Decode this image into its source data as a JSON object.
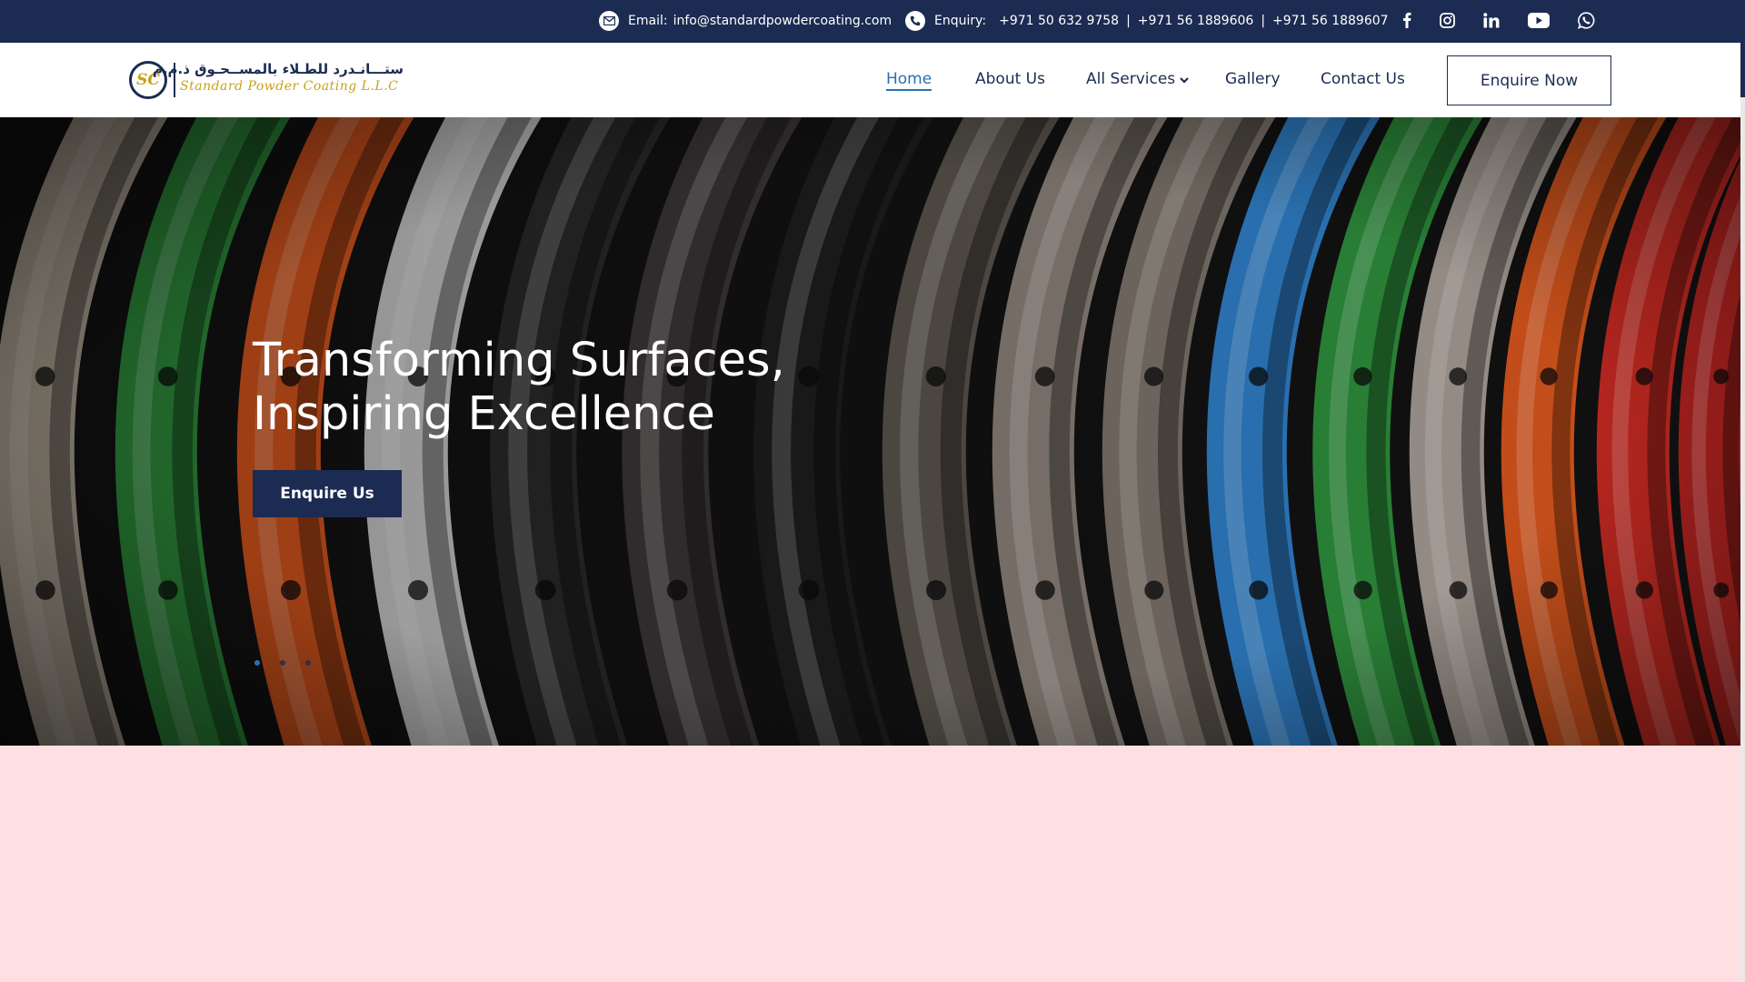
{
  "topbar": {
    "email_label": "Email:",
    "email_value": "info@standardpowdercoating.com",
    "enquiry_label": "Enquiry:",
    "phones": [
      "+971 50 632 9758",
      "+971 56 1889606",
      "+971 56 1889607"
    ],
    "separator": "|",
    "social_icons": [
      "facebook-icon",
      "instagram-icon",
      "linkedin-icon",
      "youtube-icon",
      "whatsapp-icon"
    ]
  },
  "header": {
    "logo": {
      "mark_text": "SC",
      "arabic_text": "ستـــانـدرد للطـلاء بالمســحـوق ذ.م.م",
      "english_text": "Standard Powder Coating L.L.C"
    },
    "nav": [
      {
        "label": "Home",
        "active": true
      },
      {
        "label": "About Us",
        "active": false
      },
      {
        "label": "All Services",
        "active": false,
        "has_dropdown": true
      },
      {
        "label": "Gallery",
        "active": false
      },
      {
        "label": "Contact Us",
        "active": false
      }
    ],
    "cta_label": "Enquire Now"
  },
  "hero": {
    "title_line1": "Transforming Surfaces,",
    "title_line2": "Inspiring Excellence",
    "button_label": "Enquire Us",
    "slide_count": 3,
    "active_slide": 1
  },
  "colors": {
    "primary": "#1b2b52",
    "accent": "#2a6fb3",
    "gold": "#c8a21a",
    "page_bg": "#ffdfe1"
  }
}
